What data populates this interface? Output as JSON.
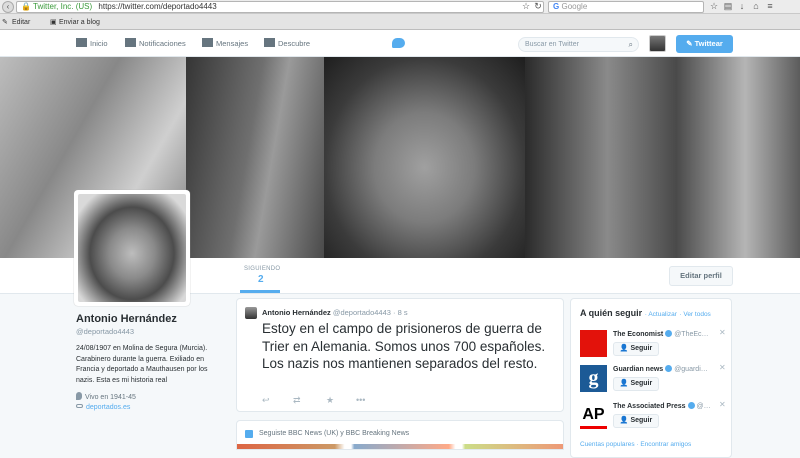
{
  "browser": {
    "url_org": "Twitter, Inc. (US)",
    "url": "https://twitter.com/deportado4443",
    "search_placeholder": "Google",
    "bookmarks": [
      "Editar",
      "Enviar a blog"
    ]
  },
  "nav": {
    "items": [
      {
        "label": "Inicio",
        "icon": "home-icon"
      },
      {
        "label": "Notificaciones",
        "icon": "bell-icon"
      },
      {
        "label": "Mensajes",
        "icon": "envelope-icon"
      },
      {
        "label": "Descubre",
        "icon": "hash-icon"
      }
    ],
    "search_placeholder": "Buscar en Twitter",
    "tweet_button": "Twittear"
  },
  "stats": {
    "label": "SIGUIENDO",
    "value": "2"
  },
  "edit_profile": "Editar perfil",
  "profile": {
    "name": "Antonio Hernández",
    "handle": "@deportado4443",
    "bio": "24/08/1907 en Molina de Segura (Murcia). Carabinero durante la guerra. Exiliado en Francia y deportado a Mauthausen por los nazis. Esta es mi historia real",
    "location": "Vivo en 1941-45",
    "url": "deportados.es"
  },
  "tweet": {
    "name": "Antonio Hernández",
    "handle": "@deportado4443",
    "time": "· 8 s",
    "text": "Estoy en el campo de prisioneros de guerra de Trier en Alemania. Somos unos 700 españoles. Los nazis nos mantienen separados del resto."
  },
  "followed": {
    "text": "Seguiste BBC News (UK) y BBC Breaking News"
  },
  "who_to_follow": {
    "title": "A quién seguir",
    "refresh": "· Actualizar",
    "view_all": "· Ver todos",
    "accounts": [
      {
        "name": "The Economist",
        "handle": "@TheEc…",
        "button": "Seguir",
        "logo_color": "#e3120b"
      },
      {
        "name": "Guardian news",
        "handle": "@guardi…",
        "button": "Seguir",
        "logo_color": "#1c5a96"
      },
      {
        "name": "The Associated Press",
        "handle": "@…",
        "button": "Seguir",
        "logo_color": "#000000"
      }
    ],
    "footer": "Cuentas populares · Encontrar amigos"
  }
}
